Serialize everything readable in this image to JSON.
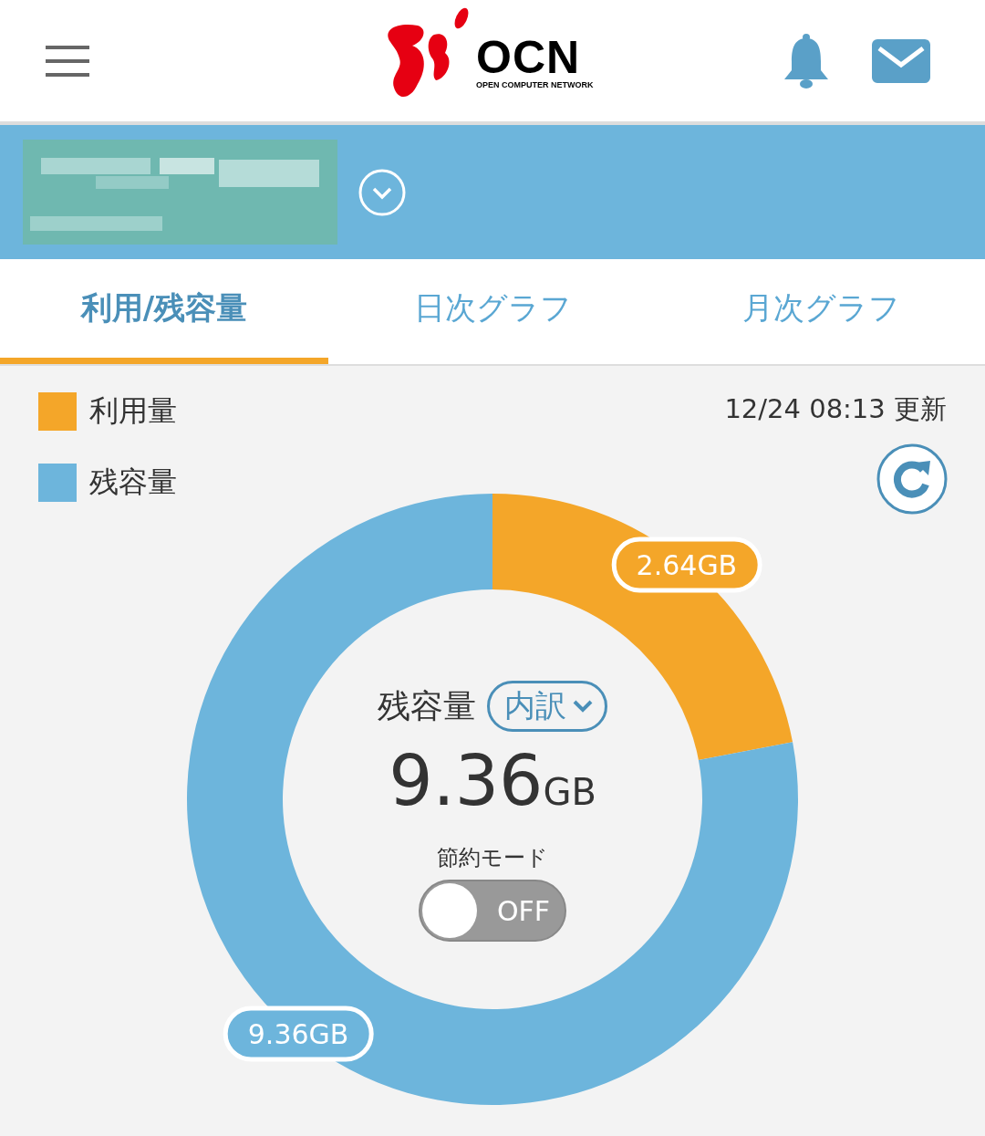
{
  "header": {
    "logo": {
      "name": "OCN",
      "subtitle": "OPEN COMPUTER NETWORK"
    }
  },
  "tabs": [
    {
      "label": "利用/残容量",
      "selected": true
    },
    {
      "label": "日次グラフ",
      "selected": false
    },
    {
      "label": "月次グラフ",
      "selected": false
    }
  ],
  "legend": [
    {
      "color": "#f4a629"
    },
    {
      "color": "#6db5dc"
    }
  ],
  "updated": "12/24 08:13 更新",
  "chart_data": {
    "type": "donut",
    "categories": [
      "利用量",
      "残容量"
    ],
    "values": [
      2.64,
      9.36
    ],
    "value_labels": [
      "2.64GB",
      "9.36GB"
    ]
  },
  "center": {
    "label": "残容量",
    "breakdown_button": "内訳",
    "value": "9.36",
    "unit": "GB"
  },
  "savings_mode": {
    "label": "節約モード",
    "on": false,
    "state_text": "OFF"
  }
}
